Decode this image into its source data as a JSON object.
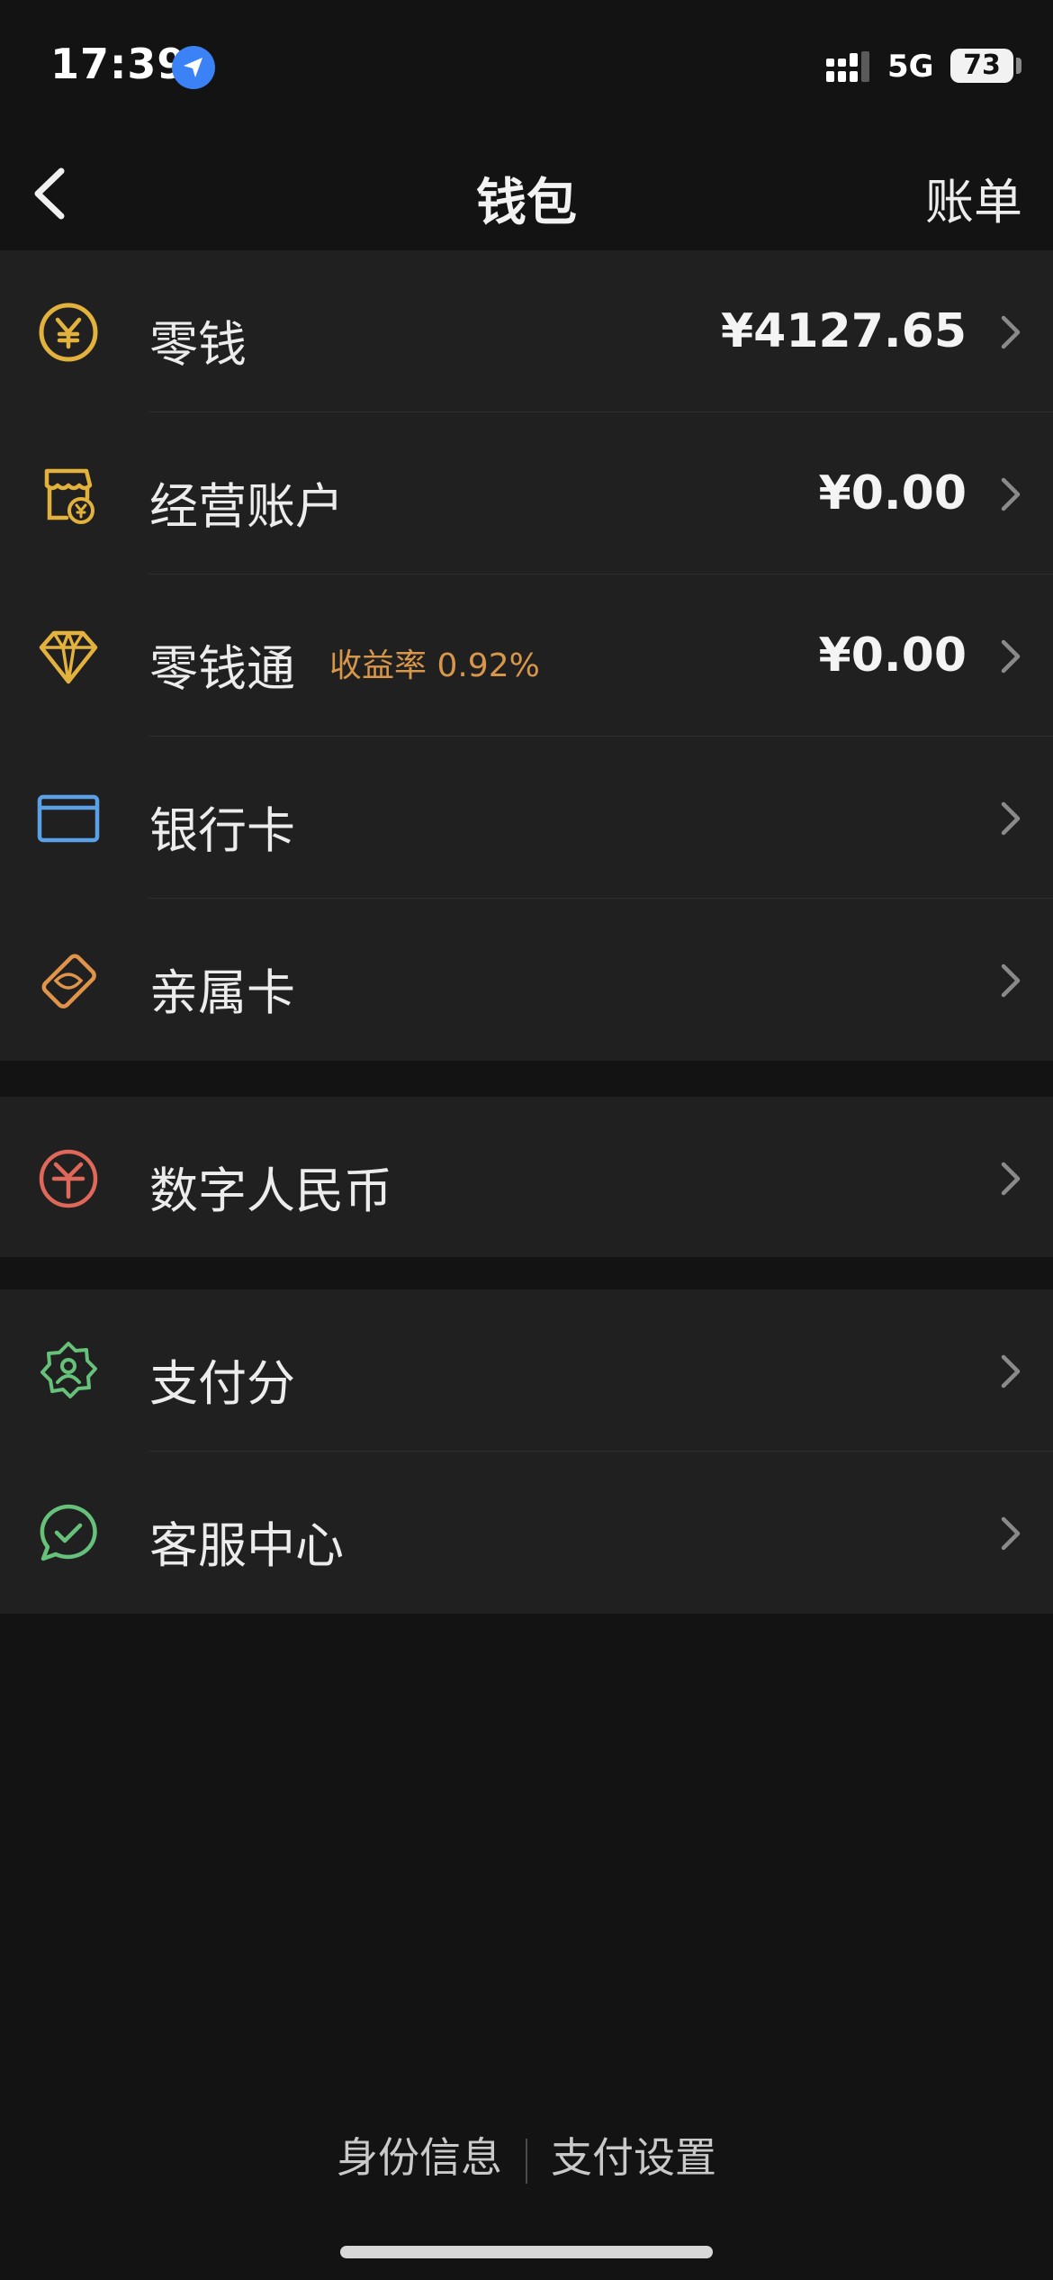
{
  "status_bar": {
    "time": "17:39",
    "network": "5G",
    "battery": "73"
  },
  "nav": {
    "title": "钱包",
    "action": "账单"
  },
  "group1": [
    {
      "label": "零钱",
      "value": "¥4127.65",
      "icon": "yuan-coin-icon",
      "color": "#e3b23c"
    },
    {
      "label": "经营账户",
      "value": "¥0.00",
      "icon": "store-icon",
      "color": "#e3b23c"
    },
    {
      "label": "零钱通",
      "sub": "收益率 0.92%",
      "value": "¥0.00",
      "icon": "diamond-icon",
      "color": "#e3b23c"
    },
    {
      "label": "银行卡",
      "icon": "bank-card-icon",
      "color": "#5aa0e6"
    },
    {
      "label": "亲属卡",
      "icon": "family-card-icon",
      "color": "#e0944a"
    }
  ],
  "group2": [
    {
      "label": "数字人民币",
      "icon": "digital-rmb-icon",
      "color": "#e0685a"
    }
  ],
  "group3": [
    {
      "label": "支付分",
      "icon": "pay-score-icon",
      "color": "#66c27a"
    },
    {
      "label": "客服中心",
      "icon": "customer-service-icon",
      "color": "#66c27a"
    }
  ],
  "footer": {
    "identity": "身份信息",
    "settings": "支付设置"
  }
}
